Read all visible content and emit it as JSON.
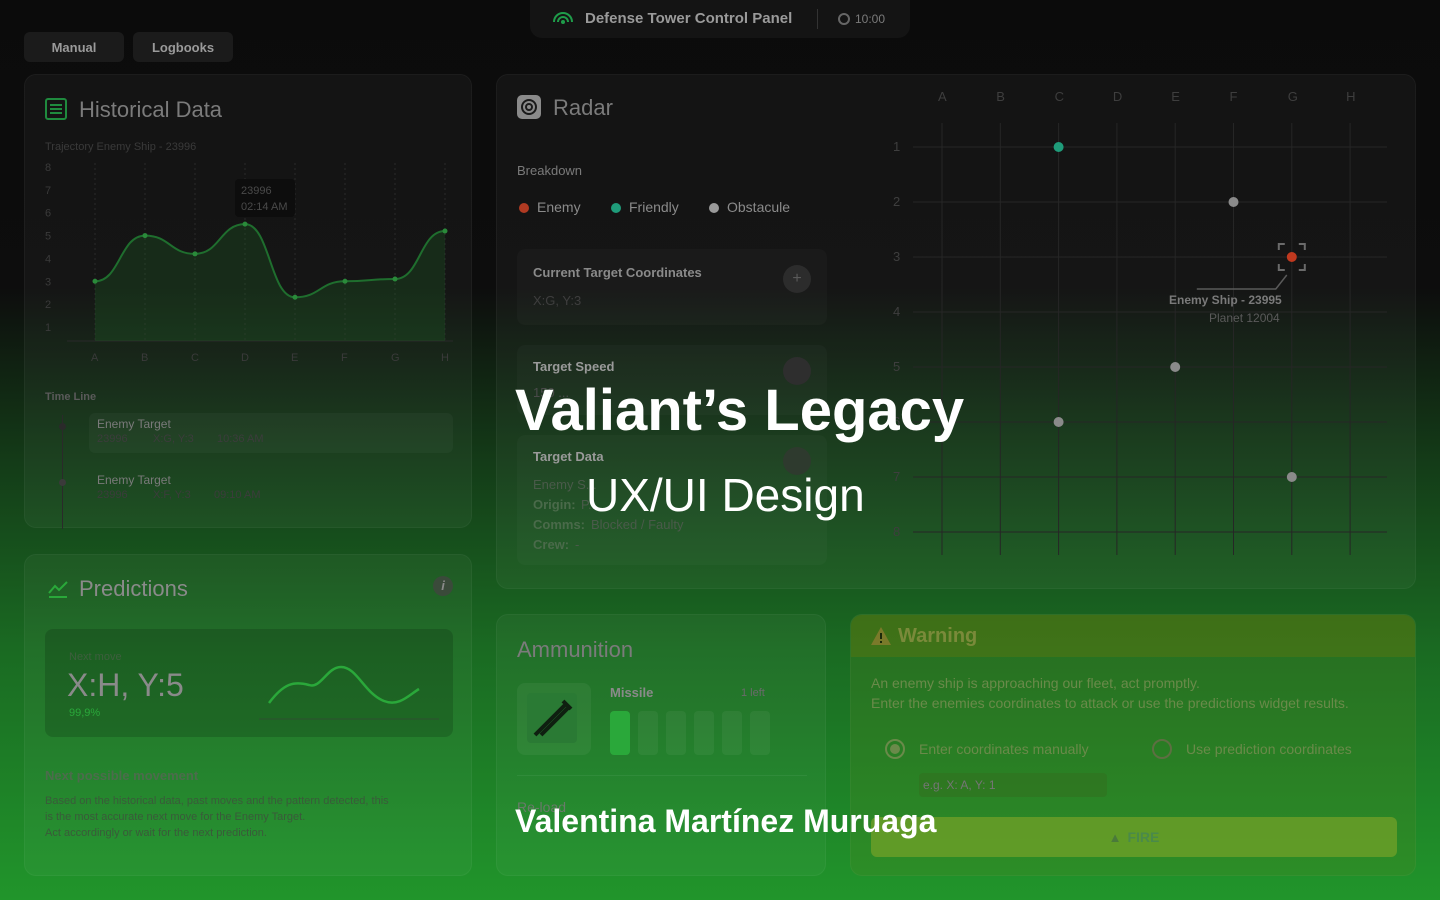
{
  "header": {
    "title": "Defense Tower Control Panel",
    "time": "10:00"
  },
  "nav": {
    "manual": "Manual",
    "logbooks": "Logbooks"
  },
  "historical": {
    "title": "Historical Data",
    "chart_title": "Trajectory Enemy Ship - 23996",
    "tooltip_id": "23996",
    "tooltip_time": "02:14 AM",
    "timeline_label": "Time Line",
    "timeline": [
      {
        "title": "Enemy Target",
        "id": "23996",
        "coords": "X:G, Y:3",
        "time": "10:36 AM"
      },
      {
        "title": "Enemy Target",
        "id": "23996",
        "coords": "X:F, Y:3",
        "time": "09:10 AM"
      }
    ]
  },
  "chart_data": {
    "type": "area",
    "categories": [
      "A",
      "B",
      "C",
      "D",
      "E",
      "F",
      "G",
      "H"
    ],
    "values": [
      3,
      5,
      4.2,
      5.5,
      2.3,
      3,
      3.1,
      5.2
    ],
    "ylim": [
      1,
      8
    ],
    "y_ticks": [
      "1",
      "2",
      "3",
      "4",
      "5",
      "6",
      "7",
      "8"
    ],
    "grid": true
  },
  "predictions": {
    "title": "Predictions",
    "next_move_label": "Next move",
    "next_move": "X:H, Y:5",
    "confidence": "99,9%",
    "subtitle": "Next possible movement",
    "description_1": "Based on the historical data, past moves and the pattern detected, this",
    "description_2": "is the most accurate next move for the Enemy Target.",
    "description_3": "Act accordingly or wait for the next prediction."
  },
  "radar": {
    "title": "Radar",
    "breakdown": "Breakdown",
    "legend": [
      {
        "label": "Enemy",
        "color": "#c0391f"
      },
      {
        "label": "Friendly",
        "color": "#1f9c7a"
      },
      {
        "label": "Obstacule",
        "color": "#9a9a9a"
      }
    ],
    "current_target_label": "Current Target Coordinates",
    "current_target_value": "X:G, Y:3",
    "target_speed_label": "Target Speed",
    "target_speed_value": "150 ...",
    "target_data_label": "Target Data",
    "target_data_line1": "Enemy S...",
    "origin_label": "Origin:",
    "origin_value": "P...",
    "comms_label": "Comms:",
    "comms_value": "Blocked / Faulty",
    "crew_label": "Crew:",
    "crew_value": "-",
    "cols": [
      "A",
      "B",
      "C",
      "D",
      "E",
      "F",
      "G",
      "H"
    ],
    "rows": [
      "1",
      "2",
      "3",
      "4",
      "5",
      "6",
      "7",
      "8"
    ],
    "ship_label": "Enemy Ship - 23995",
    "ship_sub": "Planet 12004",
    "points": [
      {
        "col": "C",
        "row": 1,
        "kind": "friendly"
      },
      {
        "col": "F",
        "row": 2,
        "kind": "obstacle"
      },
      {
        "col": "G",
        "row": 3,
        "kind": "enemy"
      },
      {
        "col": "E",
        "row": 5,
        "kind": "obstacle"
      },
      {
        "col": "C",
        "row": 6,
        "kind": "obstacle"
      },
      {
        "col": "G",
        "row": 7,
        "kind": "obstacle"
      }
    ]
  },
  "ammo": {
    "title": "Ammunition",
    "missile": "Missile",
    "left": "1 left",
    "reload": "Re-load",
    "filled": 1,
    "total": 6
  },
  "warning": {
    "title": "Warning",
    "line1": "An enemy ship is approaching our fleet, act promptly.",
    "line2": "Enter the enemies coordinates to attack or use the predictions widget results.",
    "opt_manual": "Enter coordinates manually",
    "opt_pred": "Use prediction coordinates",
    "placeholder": "e.g. X: A, Y: 1",
    "fire": "FIRE"
  },
  "overlay": {
    "title": "Valiant’s Legacy",
    "subtitle": "UX/UI Design",
    "author": "Valentina Martínez Muruaga"
  }
}
